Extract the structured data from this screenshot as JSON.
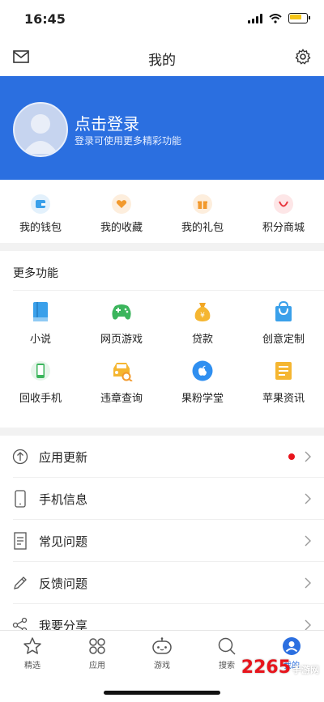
{
  "status_bar": {
    "time": "16:45"
  },
  "header": {
    "title": "我的"
  },
  "profile": {
    "login_label": "点击登录",
    "subtitle": "登录可使用更多精彩功能"
  },
  "quick_actions": [
    {
      "label": "我的钱包",
      "icon": "wallet-icon",
      "color": "#3aa0ea"
    },
    {
      "label": "我的收藏",
      "icon": "heart-icon",
      "color": "#f29a2e"
    },
    {
      "label": "我的礼包",
      "icon": "gift-icon",
      "color": "#f29a2e"
    },
    {
      "label": "积分商城",
      "icon": "smile-icon",
      "color": "#e8363e"
    }
  ],
  "more": {
    "heading": "更多功能",
    "items": [
      {
        "label": "小说",
        "icon": "book-icon"
      },
      {
        "label": "网页游戏",
        "icon": "gamepad-icon"
      },
      {
        "label": "贷款",
        "icon": "money-bag-icon"
      },
      {
        "label": "创意定制",
        "icon": "shopping-bag-icon"
      },
      {
        "label": "回收手机",
        "icon": "recycle-phone-icon"
      },
      {
        "label": "违章查询",
        "icon": "car-search-icon"
      },
      {
        "label": "果粉学堂",
        "icon": "apple-icon"
      },
      {
        "label": "苹果资讯",
        "icon": "news-icon"
      }
    ]
  },
  "menu": [
    {
      "label": "应用更新",
      "icon": "upload-circle-icon",
      "badge": true
    },
    {
      "label": "手机信息",
      "icon": "phone-outline-icon",
      "badge": false
    },
    {
      "label": "常见问题",
      "icon": "document-icon",
      "badge": false
    },
    {
      "label": "反馈问题",
      "icon": "pencil-icon",
      "badge": false
    },
    {
      "label": "我要分享",
      "icon": "share-icon",
      "badge": false
    }
  ],
  "tabbar": [
    {
      "label": "精选",
      "icon": "star-icon"
    },
    {
      "label": "应用",
      "icon": "grid-circles-icon"
    },
    {
      "label": "游戏",
      "icon": "game-controller-icon"
    },
    {
      "label": "搜索",
      "icon": "search-icon"
    },
    {
      "label": "我的",
      "icon": "user-icon",
      "active": true
    }
  ],
  "watermark": {
    "brand": "2265",
    "suffix": "手游网"
  },
  "colors": {
    "accent": "#2b6fe0",
    "badge": "#e8141c"
  }
}
